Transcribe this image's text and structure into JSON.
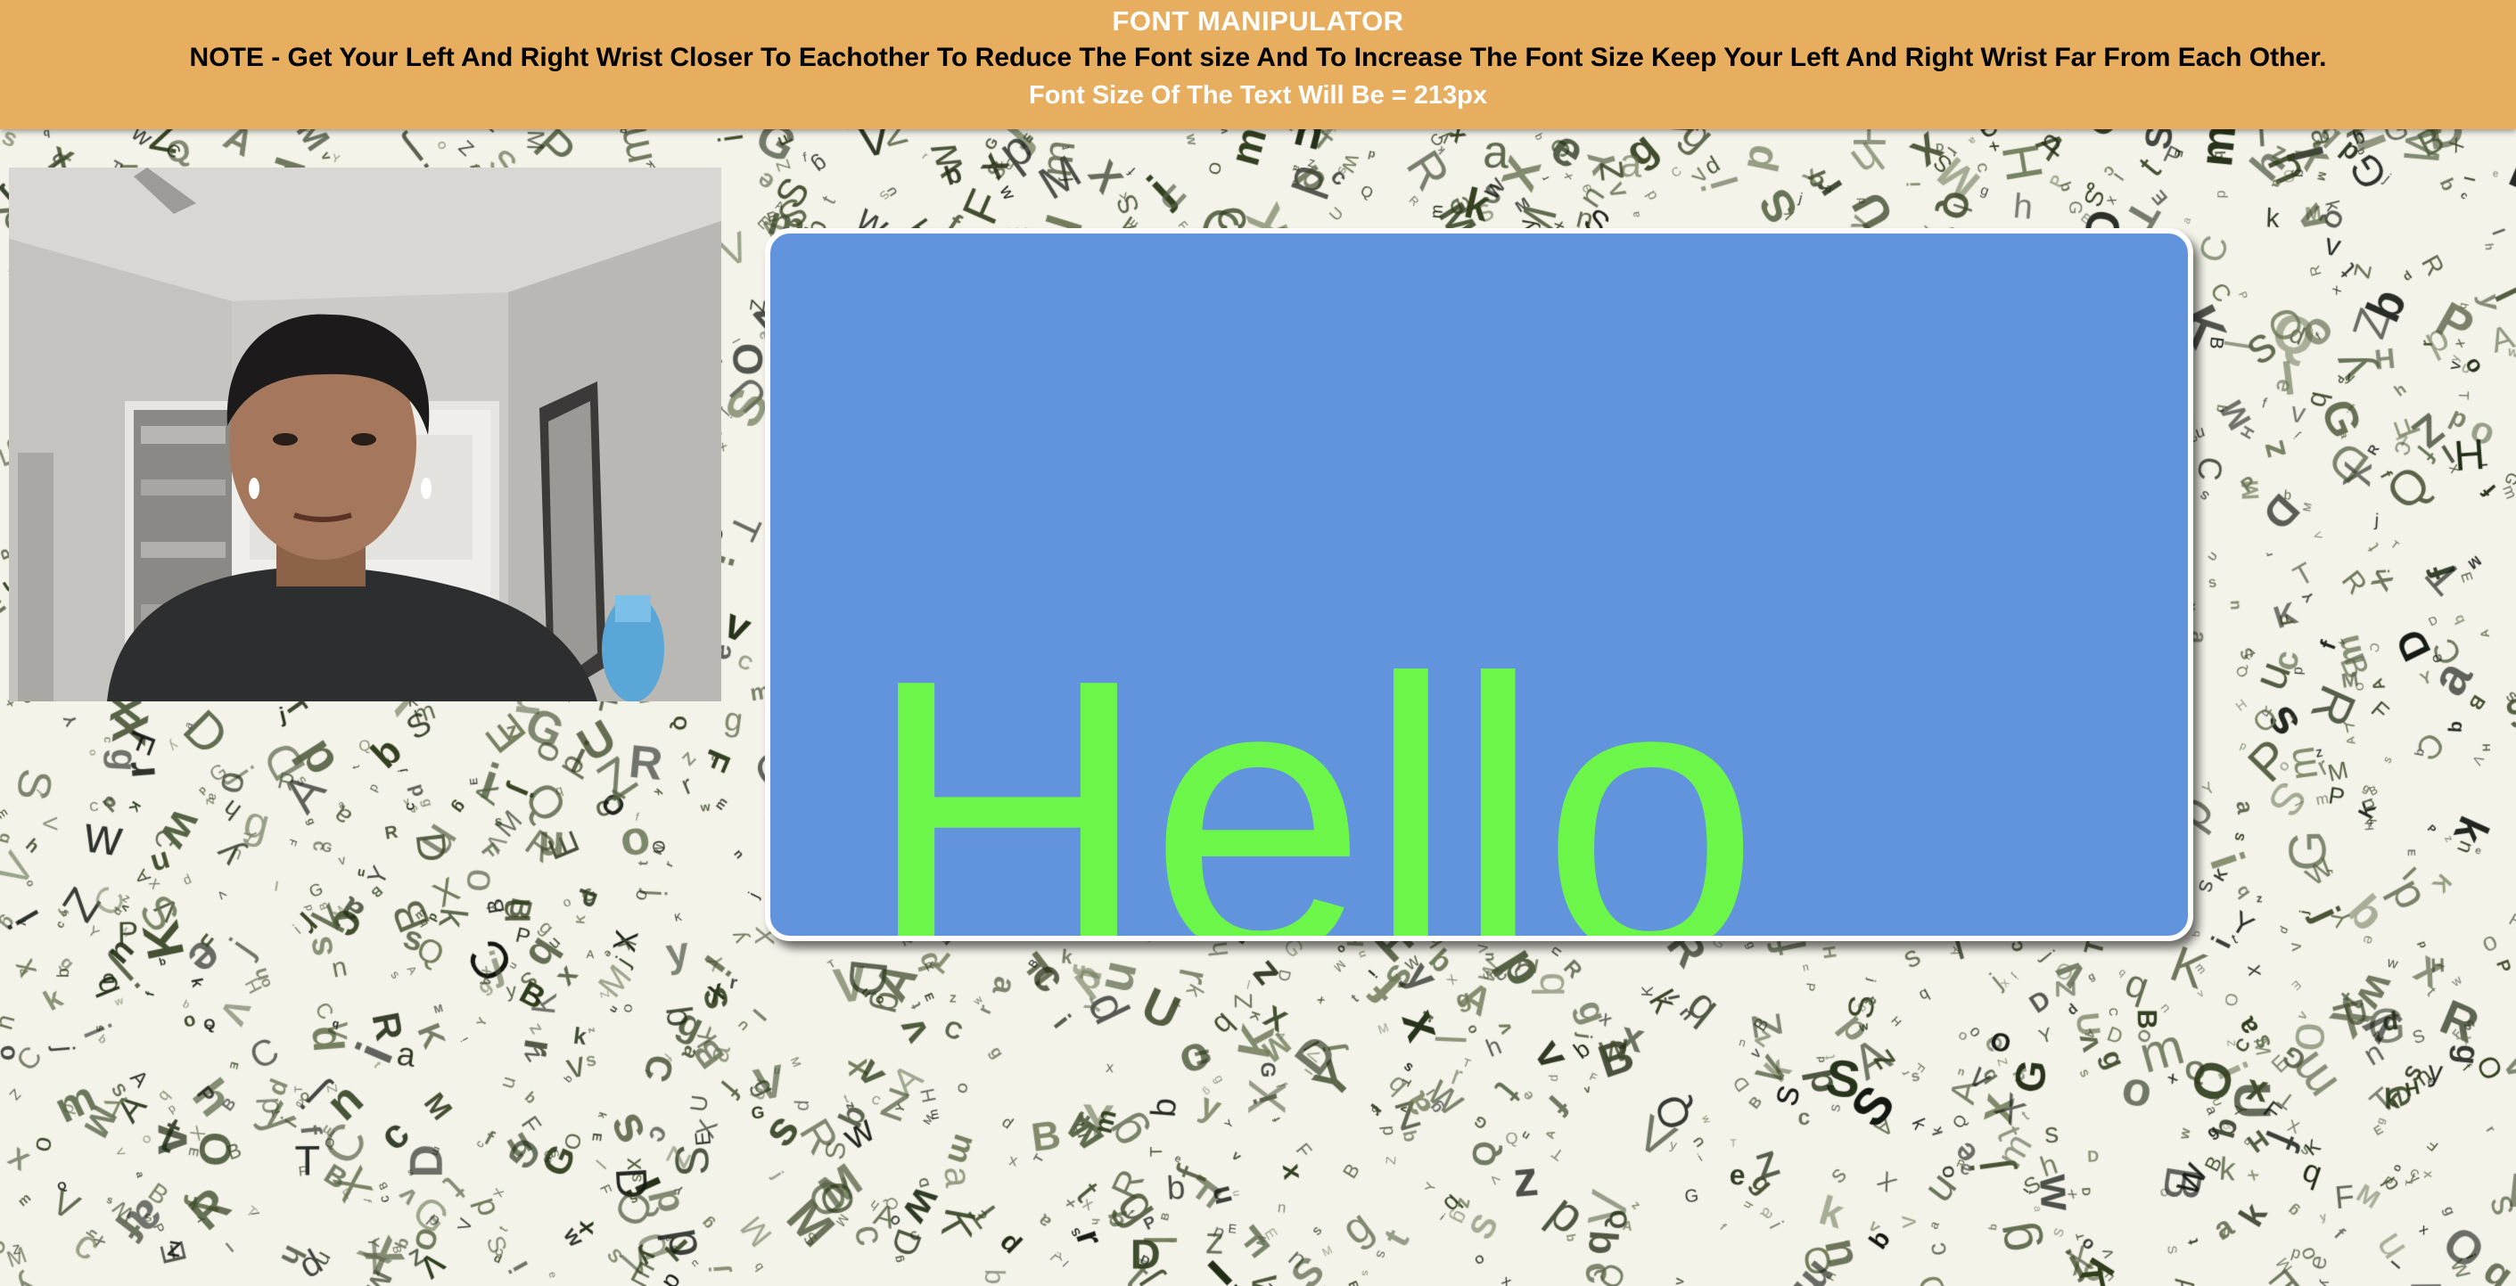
{
  "header": {
    "title": "FONT MANIPULATOR",
    "note": "NOTE - Get Your Left And Right Wrist Closer To Eachother To Reduce The Font size And To Increase The Font Size Keep Your Left And Right Wrist Far From Each Other.",
    "font_size_label": "Font Size Of The Text Will Be = 213px"
  },
  "display": {
    "text": "Hello"
  },
  "colors": {
    "header_bg": "#e8ae5f",
    "card_bg": "#6293dd",
    "text_color": "#6cf64a",
    "page_bg": "#f4f3ea"
  },
  "webcam": {
    "icon": "webcam-feed"
  }
}
